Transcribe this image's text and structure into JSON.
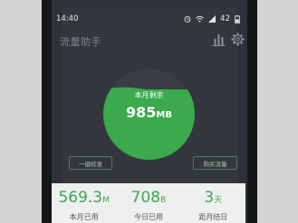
{
  "status_bar": {
    "time": "14:40",
    "battery": "42"
  },
  "header": {
    "title": "流量助手",
    "chart_icon": "bar-chart-icon",
    "settings_icon": "gear-icon"
  },
  "usage_circle": {
    "label": "本月剩余",
    "value": "985",
    "unit": "MB",
    "fill_level": 0.77,
    "fill_color": "#3aaa4d"
  },
  "buttons": {
    "calibrate": "一键校准",
    "buy": "购买流量"
  },
  "stats": [
    {
      "value": "569.3",
      "unit": "M",
      "caption": "本月已用"
    },
    {
      "value": "708",
      "unit": "B",
      "caption": "今日已用"
    },
    {
      "value": "3",
      "unit": "天",
      "caption": "距月结日"
    }
  ]
}
